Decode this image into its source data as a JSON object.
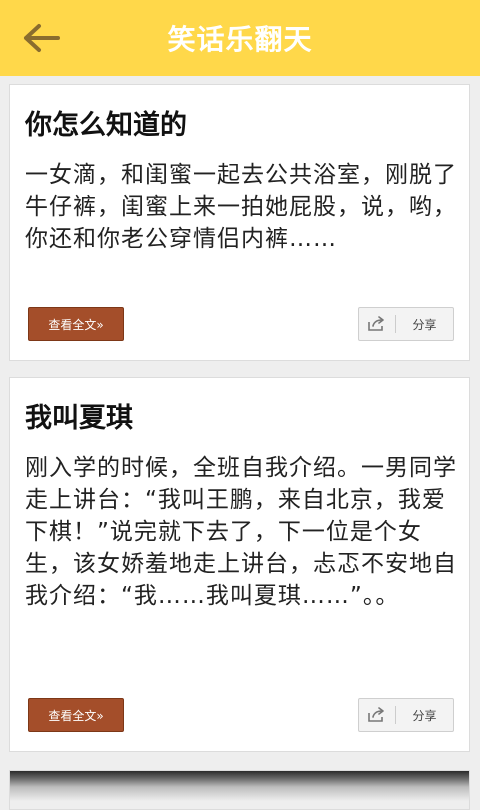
{
  "header": {
    "title": "笑话乐翻天",
    "back_icon": "arrow-left-icon"
  },
  "jokes": [
    {
      "title": "你怎么知道的",
      "body": "一女滴，和闺蜜一起去公共浴室，刚脱了牛仔裤，闺蜜上来一拍她屁股，说，哟，你还和你老公穿情侣内裤……",
      "read_label": "查看全文»",
      "share_label": "分享"
    },
    {
      "title": "我叫夏琪",
      "body": "刚入学的时候，全班自我介绍。一男同学走上讲台：“我叫王鹏，来自北京，我爱下棋！”说完就下去了，下一位是个女生，该女娇羞地走上讲台，忐忑不安地自我介绍：“我……我叫夏琪……”。。",
      "read_label": "查看全文»",
      "share_label": "分享"
    }
  ],
  "colors": {
    "header_bg": "#ffd84a",
    "read_button_bg": "#a44e2a"
  }
}
